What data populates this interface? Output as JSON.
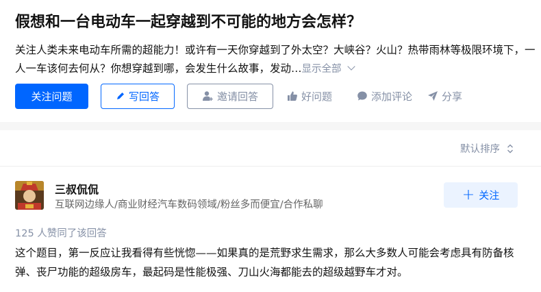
{
  "question": {
    "title": "假想和一台电动车一起穿越到不可能的地方会怎样？",
    "description": "关注人类未来电动车所需的超能力！或许有一天你穿越到了外太空？大峡谷？火山？热带雨林等极限环境下，一人一车该何去何从？你想穿越到哪，会发生什么故事，发动…",
    "show_all": "显示全部",
    "actions": {
      "follow": "关注问题",
      "write_answer": "写回答",
      "invite": "邀请回答",
      "good_question": "好问题",
      "add_comment": "添加评论",
      "share": "分享"
    }
  },
  "answers": {
    "sort_label": "默认排序",
    "first": {
      "author_name": "三叔侃侃",
      "author_bio": "互联网边缘人/商业财经汽车数码领域/粉丝多而便宜/合作私聊",
      "follow_label": "关注",
      "votes_text": "125 人赞同了该回答",
      "content": "这个题目，第一反应让我看得有些恍惚——如果真的是荒野求生需求，那么大多数人可能会考虑具有防备核弹、丧尸功能的超级房车，最起码是性能极强、刀山火海都能去的超级越野车才对。"
    }
  },
  "colors": {
    "primary": "#0066ff",
    "muted": "#8590a6",
    "text": "#121212",
    "follow_bg": "#ebf3ff"
  },
  "icons": [
    "pen-icon",
    "add-user-icon",
    "thumb-up-icon",
    "comment-icon",
    "share-icon",
    "chevron-down-icon",
    "sort-icon",
    "plus-icon"
  ]
}
